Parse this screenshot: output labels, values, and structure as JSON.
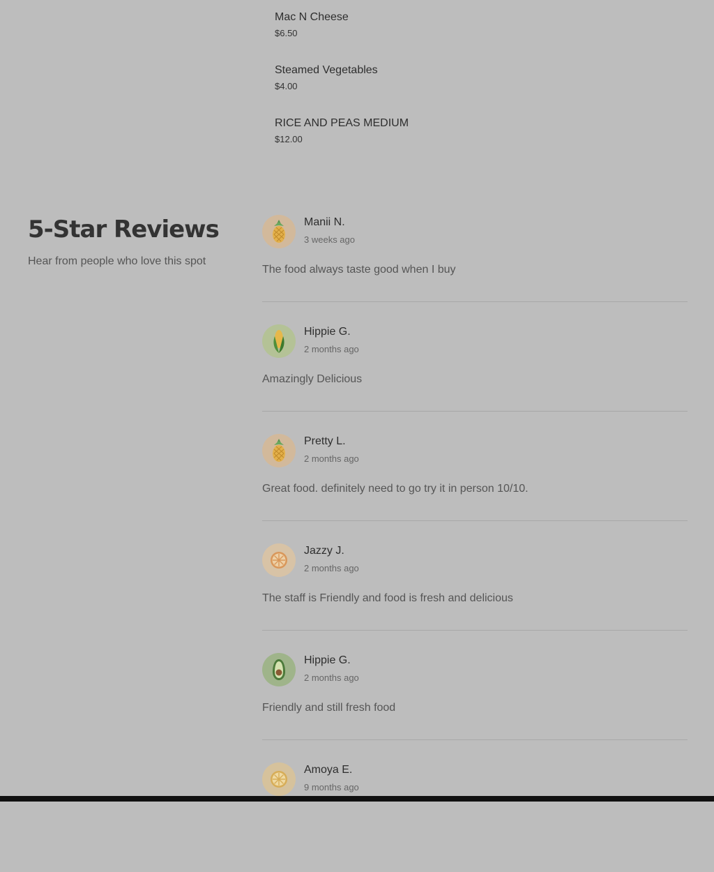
{
  "menu": {
    "items": [
      {
        "name": "Mac N Cheese",
        "price": "$6.50"
      },
      {
        "name": "Steamed Vegetables",
        "price": "$4.00"
      },
      {
        "name": "RICE AND PEAS MEDIUM",
        "price": "$12.00"
      }
    ]
  },
  "reviews_section": {
    "title": "5-Star Reviews",
    "subtitle": "Hear from people who love this spot"
  },
  "reviews": [
    {
      "name": "Manii N.",
      "date": "3 weeks ago",
      "text": "The food always taste good when I buy",
      "avatar_icon": "pineapple-icon"
    },
    {
      "name": "Hippie G.",
      "date": "2 months ago",
      "text": "Amazingly Delicious",
      "avatar_icon": "corn-icon"
    },
    {
      "name": "Pretty L.",
      "date": "2 months ago",
      "text": "Great food. definitely need to go try it in person 10/10.",
      "avatar_icon": "pineapple-icon"
    },
    {
      "name": "Jazzy J.",
      "date": "2 months ago",
      "text": "The staff is Friendly and food is fresh and delicious",
      "avatar_icon": "orange-slice-icon"
    },
    {
      "name": "Hippie G.",
      "date": "2 months ago",
      "text": "Friendly and still fresh food",
      "avatar_icon": "avocado-icon"
    },
    {
      "name": "Amoya E.",
      "date": "9 months ago",
      "text": "",
      "avatar_icon": "lemon-slice-icon"
    }
  ],
  "colors": {
    "background": "#bdbdbd",
    "text_primary": "#333333",
    "text_secondary": "#555555",
    "divider": "#a8a8a8"
  }
}
